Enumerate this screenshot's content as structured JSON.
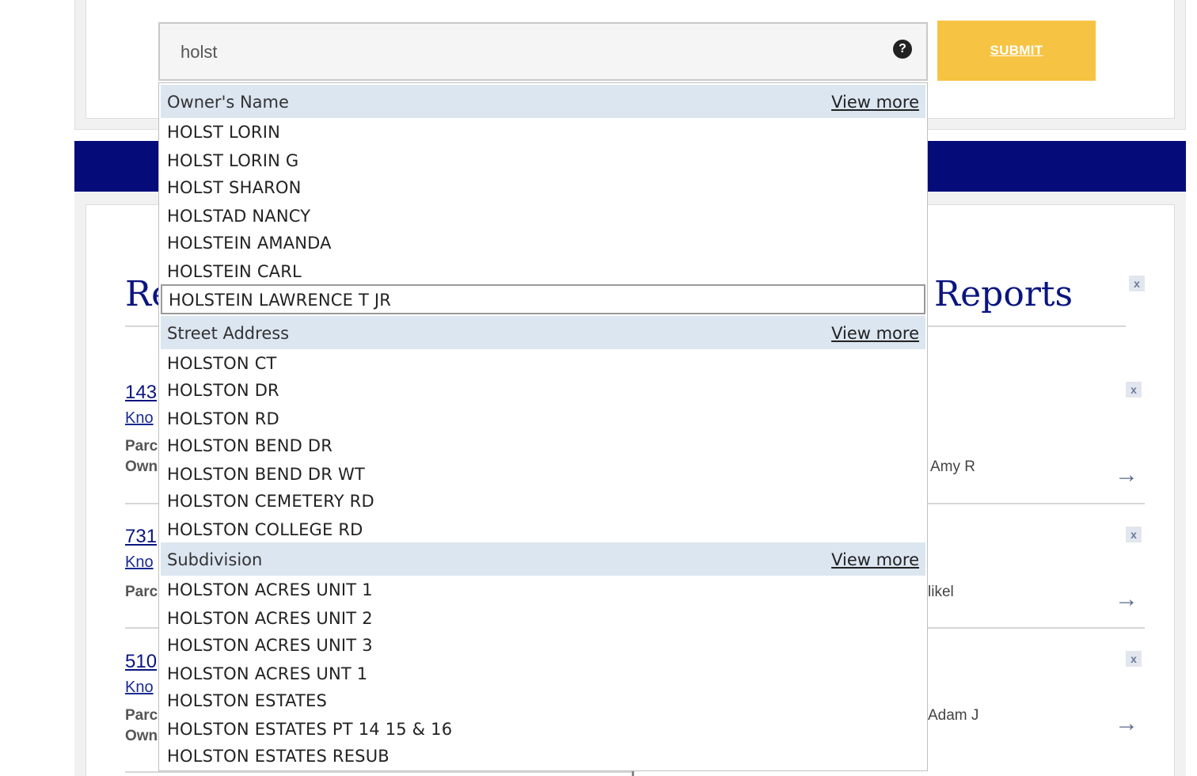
{
  "search": {
    "value": "holst",
    "help_glyph": "?",
    "submit_label": "SUBMIT"
  },
  "background": {
    "heading_left": "Re",
    "heading_right": "Reports",
    "close_glyph": "x",
    "arrow_glyph": "→",
    "records": [
      {
        "number": "143",
        "sub": "Kno",
        "label1": "Parc",
        "label2": "Own",
        "owner_tail": "Amy R"
      },
      {
        "number": "731",
        "sub": "Kno",
        "label1": "Parc",
        "owner_tail": "likel"
      },
      {
        "number": "510",
        "sub": "Kno",
        "label1": "Parc",
        "label2": "Own",
        "owner_tail": "Adam J"
      }
    ]
  },
  "dropdown": {
    "groups": [
      {
        "title": "Owner's Name",
        "view_more": "View more",
        "items": [
          "HOLST LORIN",
          "HOLST LORIN G",
          "HOLST SHARON",
          "HOLSTAD NANCY",
          "HOLSTEIN AMANDA",
          "HOLSTEIN CARL",
          "HOLSTEIN LAWRENCE T JR"
        ],
        "selected_index": 6
      },
      {
        "title": "Street Address",
        "view_more": "View more",
        "items": [
          "HOLSTON CT",
          "HOLSTON DR",
          "HOLSTON RD",
          "HOLSTON BEND DR",
          "HOLSTON BEND DR WT",
          "HOLSTON CEMETERY RD",
          "HOLSTON COLLEGE RD"
        ]
      },
      {
        "title": "Subdivision",
        "view_more": "View more",
        "items": [
          "HOLSTON ACRES UNIT 1",
          "HOLSTON ACRES UNIT 2",
          "HOLSTON ACRES UNIT 3",
          "HOLSTON ACRES UNT 1",
          "HOLSTON ESTATES",
          "HOLSTON ESTATES PT 14 15 & 16",
          "HOLSTON ESTATES RESUB"
        ]
      }
    ]
  },
  "colors": {
    "accent_submit": "#f7c342",
    "nav_band": "#050c7a",
    "group_header": "#dce6f1",
    "heading": "#0a1580"
  }
}
